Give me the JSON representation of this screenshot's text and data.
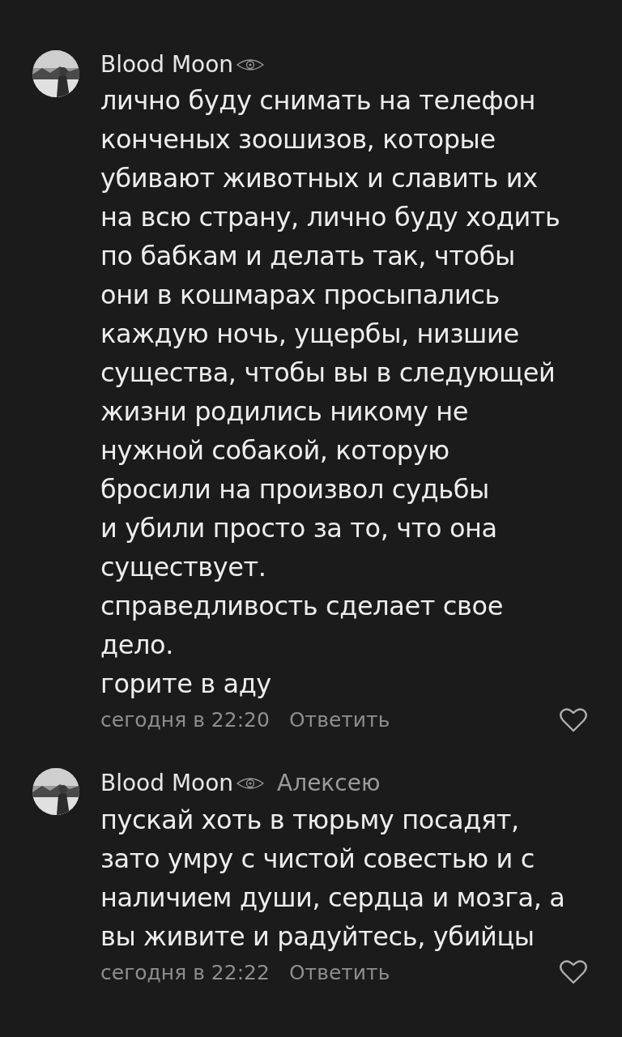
{
  "comments": [
    {
      "author": "Blood Moon",
      "lines": [
        "лично буду снимать на телефон",
        "конченых зоошизов, которые",
        "убивают животных и славить их",
        "на всю страну, лично буду ходить",
        "по бабкам и делать так, чтобы",
        "они в кошмарах просыпались",
        "каждую ночь, ущербы, низшие",
        "существа, чтобы вы в следующей",
        "жизни родились никому не",
        "нужной собакой, которую",
        "бросили на произвол судьбы",
        "и убили просто за то, что она",
        "существует.",
        "справедливость сделает свое",
        "дело.",
        "горите в аду"
      ],
      "time": "сегодня в 22:20",
      "reply_label": "Ответить",
      "liked": false
    },
    {
      "author": "Blood Moon",
      "reply_to": "Алексею",
      "lines": [
        "пускай хоть в тюрьму посадят,",
        "зато умру с чистой совестью и с",
        "наличием души, сердца и мозга, а",
        "вы живите и радуйтесь, убийцы"
      ],
      "time": "сегодня в 22:22",
      "reply_label": "Ответить",
      "liked": false
    }
  ]
}
